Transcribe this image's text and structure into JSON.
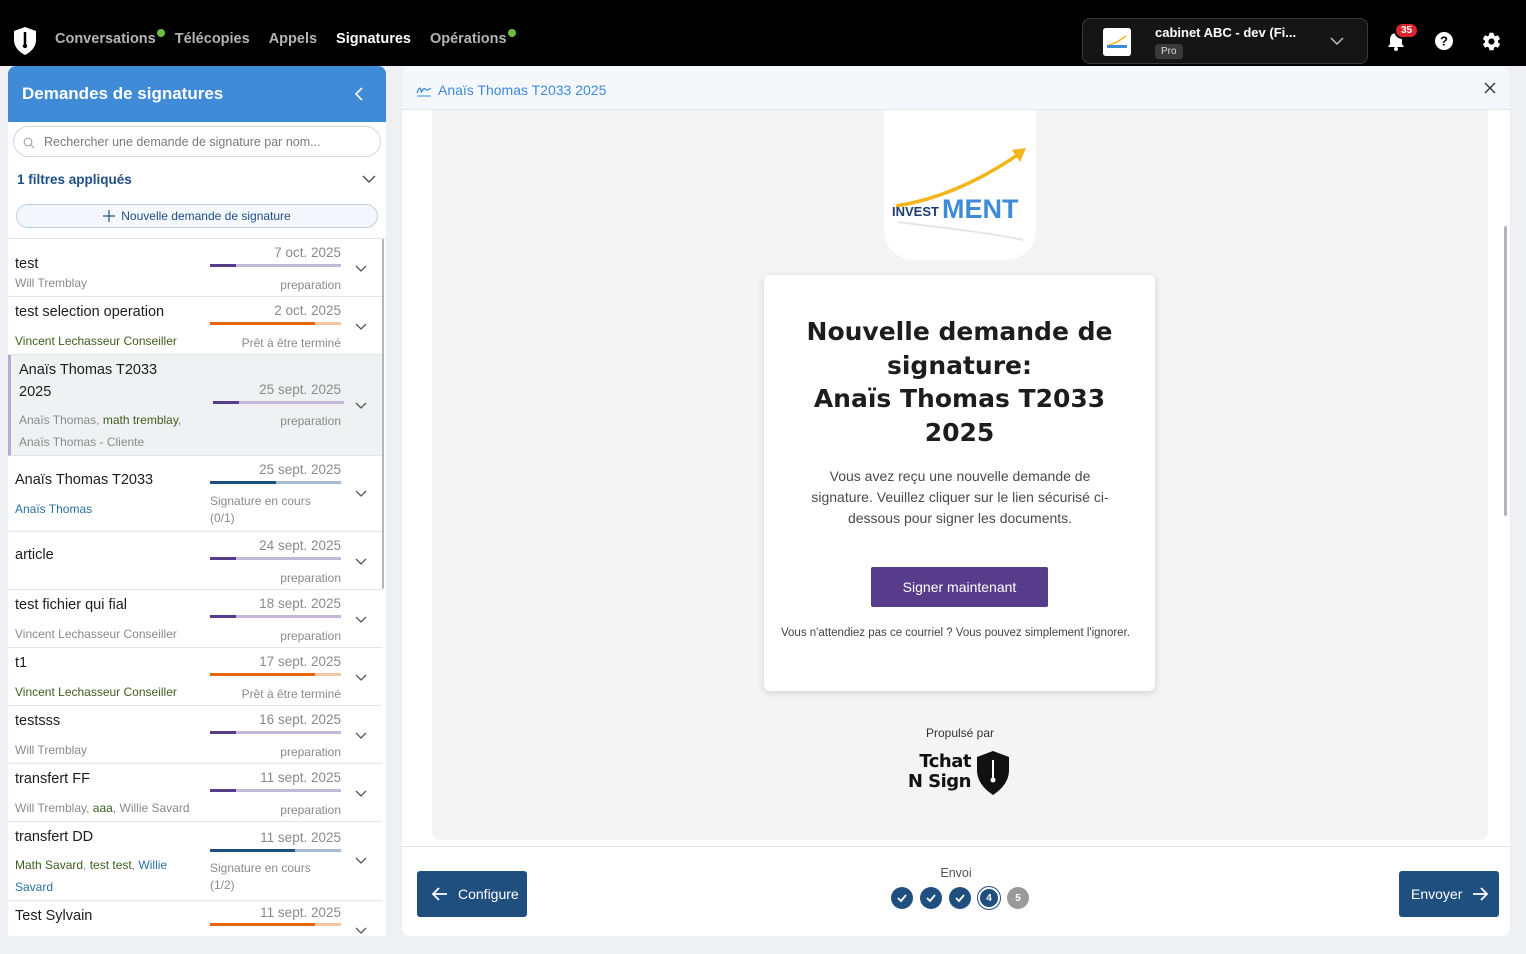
{
  "nav": {
    "items": [
      {
        "label": "Conversations",
        "dot": true,
        "active": false
      },
      {
        "label": "Télécopies",
        "dot": false,
        "active": false
      },
      {
        "label": "Appels",
        "dot": false,
        "active": false
      },
      {
        "label": "Signatures",
        "dot": false,
        "active": true
      },
      {
        "label": "Opérations",
        "dot": true,
        "active": false
      }
    ]
  },
  "account": {
    "name": "cabinet ABC - dev (Fi...",
    "plan": "Pro"
  },
  "notifications": {
    "count": "35"
  },
  "colors": {
    "accent": "#3f8bd8",
    "primary": "#1f4f7f",
    "purple": "#573c8c",
    "orange": "#e8650f"
  },
  "left_panel": {
    "title": "Demandes de signatures",
    "search_placeholder": "Rechercher une demande de signature par nom...",
    "filters_label": "1 filtres appliqués",
    "new_button": "Nouvelle demande de signature"
  },
  "requests": [
    {
      "title": "test",
      "people": [
        {
          "name": "Will Tremblay",
          "tone": "gray"
        }
      ],
      "date": "7 oct. 2025",
      "status": "preparation",
      "progress": 0.2,
      "color": "purple"
    },
    {
      "title": "test selection operation",
      "people": [
        {
          "name": "Vincent Lechasseur Conseiller",
          "tone": "green"
        }
      ],
      "date": "2 oct. 2025",
      "status": "Prêt à être terminé",
      "progress": 0.8,
      "color": "orange"
    },
    {
      "title": "Anaïs Thomas T2033 2025",
      "people": [
        {
          "name": "Anaïs Thomas",
          "tone": "gray"
        },
        {
          "name": "math tremblay",
          "tone": "green"
        },
        {
          "name": "Anaïs Thomas - Cliente",
          "tone": "gray"
        }
      ],
      "date": "25 sept. 2025",
      "status": "preparation",
      "progress": 0.2,
      "color": "purple",
      "selected": true
    },
    {
      "title": "Anaïs Thomas T2033",
      "people": [
        {
          "name": "Anaïs Thomas",
          "tone": "blue"
        }
      ],
      "date": "25 sept. 2025",
      "status": "Signature en cours",
      "status_detail": "(0/1)",
      "progress": 0.5,
      "color": "blue"
    },
    {
      "title": "article",
      "people": [],
      "date": "24 sept. 2025",
      "status": "preparation",
      "progress": 0.2,
      "color": "purple"
    },
    {
      "title": "test fichier qui fial",
      "people": [
        {
          "name": "Vincent Lechasseur Conseiller",
          "tone": "gray"
        }
      ],
      "date": "18 sept. 2025",
      "status": "preparation",
      "progress": 0.2,
      "color": "purple"
    },
    {
      "title": "t1",
      "people": [
        {
          "name": "Vincent Lechasseur Conseiller",
          "tone": "green"
        }
      ],
      "date": "17 sept. 2025",
      "status": "Prêt à être terminé",
      "progress": 0.8,
      "color": "orange"
    },
    {
      "title": "testsss",
      "people": [
        {
          "name": "Will Tremblay",
          "tone": "gray"
        }
      ],
      "date": "16 sept. 2025",
      "status": "preparation",
      "progress": 0.2,
      "color": "purple"
    },
    {
      "title": "transfert FF",
      "people": [
        {
          "name": "Will Tremblay",
          "tone": "gray"
        },
        {
          "name": "aaa",
          "tone": "green"
        },
        {
          "name": "Willie Savard",
          "tone": "gray"
        }
      ],
      "date": "11 sept. 2025",
      "status": "preparation",
      "progress": 0.2,
      "color": "purple"
    },
    {
      "title": "transfert DD",
      "people": [
        {
          "name": "Math Savard",
          "tone": "green"
        },
        {
          "name": "test test",
          "tone": "green"
        },
        {
          "name": "Willie Savard",
          "tone": "blue"
        }
      ],
      "date": "11 sept. 2025",
      "status": "Signature en cours",
      "status_detail": "(1/2)",
      "progress": 0.65,
      "color": "blue"
    },
    {
      "title": "Test Sylvain",
      "people": [],
      "date": "11 sept. 2025",
      "status": "",
      "progress": 0.8,
      "color": "orange"
    }
  ],
  "right_panel": {
    "title": "Anaïs Thomas T2033 2025",
    "email": {
      "heading_line1": "Nouvelle demande de signature:",
      "heading_line2": "Anaïs Thomas T2033 2025",
      "body": "Vous avez reçu une nouvelle demande de signature. Veuillez cliquer sur le lien sécurisé ci-dessous pour signer les documents.",
      "button": "Signer maintenant",
      "note": "Vous n'attendiez pas ce courriel ? Vous pouvez simplement l'ignorer."
    },
    "brand_logo_text": {
      "part1": "INVEST",
      "part2": "MENT"
    },
    "powered_by": "Propulsé par",
    "powered_brand": {
      "line1": "Tchat",
      "line2": "N Sign"
    }
  },
  "footer": {
    "back_label": "Configure",
    "step_label": "Envoi",
    "steps": [
      {
        "state": "done",
        "label": ""
      },
      {
        "state": "done",
        "label": ""
      },
      {
        "state": "done",
        "label": ""
      },
      {
        "state": "current",
        "label": "4"
      },
      {
        "state": "todo",
        "label": "5"
      }
    ],
    "send_label": "Envoyer"
  }
}
